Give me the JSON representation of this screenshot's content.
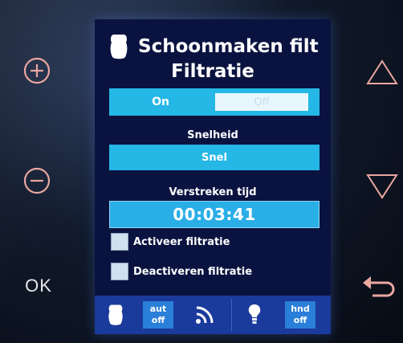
{
  "device": {
    "ok_label": "OK"
  },
  "screen": {
    "title": "Schoonmaken filt",
    "subtitle": "Filtratie",
    "toggle": {
      "on_label": "On",
      "off_label": "Off"
    },
    "speed": {
      "label": "Snelheid",
      "value": "Snel"
    },
    "elapsed": {
      "label": "Verstreken tijd",
      "value": "00:03:41"
    },
    "options": [
      {
        "label": "Activeer filtratie",
        "checked": false
      },
      {
        "label": "Deactiveren filtratie",
        "checked": false
      }
    ],
    "bottom_bar": {
      "auto_line1": "aut",
      "auto_line2": "off",
      "manual_line1": "hnd",
      "manual_line2": "off"
    }
  },
  "colors": {
    "screen_bg": "#0a1340",
    "accent": "#25b7e6",
    "bottom_bar": "#1a3a9c",
    "button_glyph": "#e9a7a0"
  },
  "icons": [
    "plus-circle-icon",
    "minus-circle-icon",
    "up-triangle-icon",
    "down-triangle-icon",
    "back-arrow-icon",
    "filter-icon",
    "wifi-icon",
    "lightbulb-icon"
  ]
}
